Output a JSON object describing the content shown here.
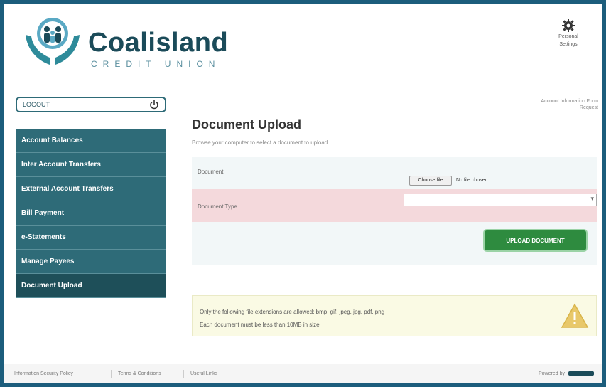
{
  "header": {
    "brand_name": "Coalisland",
    "brand_sub": "CREDIT UNION",
    "settings_label_line1": "Personal",
    "settings_label_line2": "Settings"
  },
  "sidebar": {
    "logout_label": "LOGOUT",
    "items": [
      {
        "label": "Account Balances"
      },
      {
        "label": "Inter Account Transfers"
      },
      {
        "label": "External Account Transfers"
      },
      {
        "label": "Bill Payment"
      },
      {
        "label": "e-Statements"
      },
      {
        "label": "Manage Payees"
      },
      {
        "label": "Document Upload"
      }
    ]
  },
  "main": {
    "top_link_line1": "Account Information Form",
    "top_link_line2": "Request",
    "title": "Document Upload",
    "subtitle": "Browse your computer to select a document to upload.",
    "document_label": "Document",
    "file_button_label": "Choose file",
    "file_status": "No file chosen",
    "document_type_label": "Document Type",
    "document_type_value": "",
    "upload_button_label": "UPLOAD DOCUMENT",
    "notice_line1": "Only the following file extensions are allowed: bmp, gif, jpeg, jpg, pdf, png",
    "notice_line2": "Each document must be less than 10MB in size."
  },
  "footer": {
    "links": [
      "Information Security Policy",
      "Terms & Conditions",
      "Useful Links"
    ],
    "powered_by": "Powered by"
  },
  "colors": {
    "frame": "#1c5d7c",
    "nav_bg": "#2e6b78",
    "nav_active": "#1e4f59",
    "brand": "#1b4b59",
    "error_row": "#f4d9dc",
    "upload_button": "#2e8b3f",
    "notice_bg": "#fafae4",
    "warning": "#d9b54a"
  }
}
